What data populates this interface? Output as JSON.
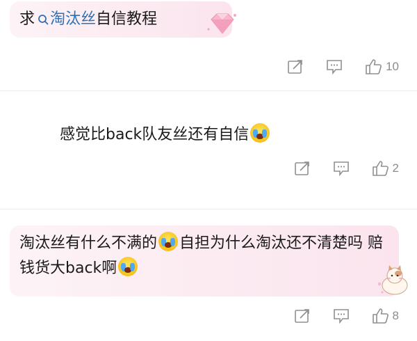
{
  "comments": [
    {
      "parts": {
        "prefix": "求",
        "link": "淘汰丝",
        "suffix": "自信教程"
      },
      "share_icon": "share-icon",
      "reply_icon": "comment-icon",
      "like_count": "10"
    },
    {
      "text": "感觉比back队友丝还有自信",
      "like_count": "2"
    },
    {
      "parts": {
        "a": "淘汰丝有什么不满的",
        "b": "自担为什么淘汰还不清楚吗 赔钱货大back啊"
      },
      "like_count": "8"
    }
  ],
  "colors": {
    "link": "#2f6fb3",
    "bubble": "#fbe9f0",
    "icon": "#9a9a9a"
  },
  "emoji": "crying-face"
}
